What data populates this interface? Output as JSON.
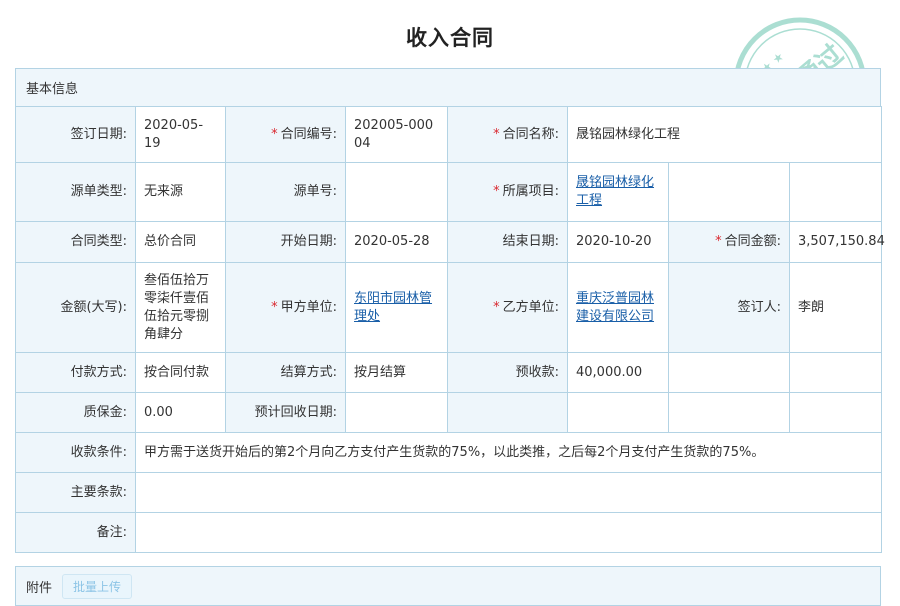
{
  "page": {
    "title": "收入合同"
  },
  "section": {
    "basic_info": "基本信息"
  },
  "labels": {
    "sign_date": "签订日期:",
    "contract_no": "合同编号:",
    "contract_name": "合同名称:",
    "source_type": "源单类型:",
    "source_no": "源单号:",
    "project": "所属项目:",
    "contract_type": "合同类型:",
    "start_date": "开始日期:",
    "end_date": "结束日期:",
    "contract_amount": "合同金额:",
    "amount_upper": "金额(大写):",
    "party_a": "甲方单位:",
    "party_b": "乙方单位:",
    "signer": "签订人:",
    "pay_method": "付款方式:",
    "settle_method": "结算方式:",
    "prepaid": "预收款:",
    "deposit": "质保金:",
    "expected_recovery_date": "预计回收日期:",
    "terms_payment": "收款条件:",
    "main_terms": "主要条款:",
    "remark": "备注:"
  },
  "values": {
    "sign_date": "2020-05-19",
    "contract_no": "202005-00004",
    "contract_name": "晟铭园林绿化工程",
    "source_type": "无来源",
    "source_no": "",
    "project": "晟铭园林绿化工程",
    "contract_type": "总价合同",
    "start_date": "2020-05-28",
    "end_date": "2020-10-20",
    "contract_amount": "3,507,150.84",
    "amount_upper": "叁佰伍拾万零柒仟壹佰伍拾元零捌角肆分",
    "party_a": "东阳市园林管理处",
    "party_b": "重庆泛普园林建设有限公司",
    "signer": "李朗",
    "pay_method": "按合同付款",
    "settle_method": "按月结算",
    "prepaid": "40,000.00",
    "deposit": "0.00",
    "expected_recovery_date": "",
    "terms_payment": "甲方需于送货开始后的第2个月向乙方支付产生货款的75%，以此类推，之后每2个月支付产生货款的75%。",
    "main_terms": "",
    "remark": ""
  },
  "attachments": {
    "label": "附件",
    "upload_button": "批量上传"
  },
  "stamp": {
    "text": "审核通过",
    "icon": "approved-stamp-icon",
    "color": "#8fd3c4"
  },
  "colors": {
    "border": "#b3d3e4",
    "label_bg": "#eef6fb",
    "required": "#d9272e",
    "link": "#1a5fa8"
  }
}
